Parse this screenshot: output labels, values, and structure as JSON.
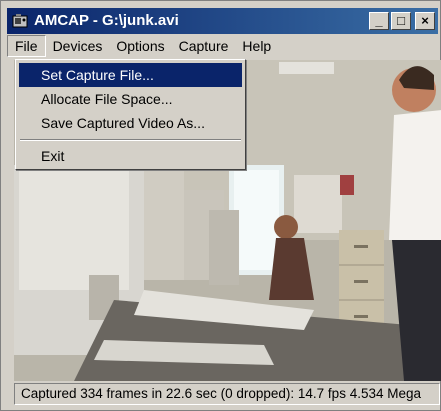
{
  "window": {
    "title": "AMCAP - G:\\junk.avi",
    "minimize_label": "_",
    "maximize_label": "□",
    "close_label": "×"
  },
  "menubar": {
    "items": [
      "File",
      "Devices",
      "Options",
      "Capture",
      "Help"
    ]
  },
  "file_menu": {
    "items": [
      "Set Capture File...",
      "Allocate File Space...",
      "Save Captured Video As...",
      "Exit"
    ]
  },
  "status": {
    "text": "Captured 334 frames in 22.6 sec (0 dropped): 14.7 fps 4.534 Mega"
  }
}
